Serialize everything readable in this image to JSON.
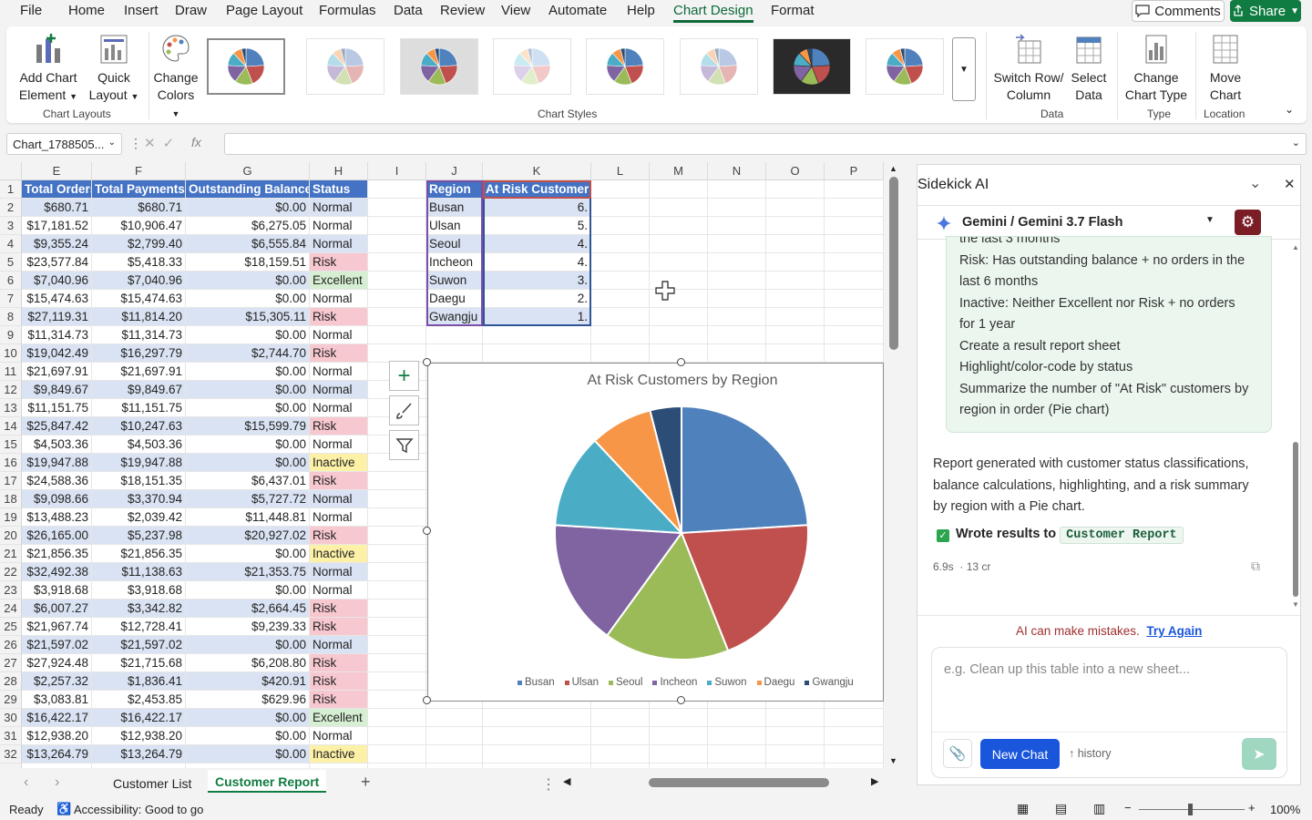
{
  "menu": {
    "items": [
      "File",
      "Home",
      "Insert",
      "Draw",
      "Page Layout",
      "Formulas",
      "Data",
      "Review",
      "View",
      "Automate",
      "Help",
      "Chart Design",
      "Format"
    ],
    "active": "Chart Design",
    "comments": "Comments",
    "share": "Share"
  },
  "ribbon": {
    "add_chart_element": [
      "Add Chart",
      "Element"
    ],
    "quick_layout": [
      "Quick",
      "Layout"
    ],
    "change_colors": [
      "Change",
      "Colors"
    ],
    "switch_row_col": [
      "Switch Row/",
      "Column"
    ],
    "select_data": [
      "Select",
      "Data"
    ],
    "change_chart_type": [
      "Change",
      "Chart Type"
    ],
    "move_chart": [
      "Move",
      "Chart"
    ],
    "groups": {
      "chart_layouts": "Chart Layouts",
      "chart_styles": "Chart Styles",
      "data": "Data",
      "type": "Type",
      "location": "Location"
    }
  },
  "formula_bar": {
    "name_box": "Chart_1788505...",
    "fx": "fx"
  },
  "sheet": {
    "columns": [
      "E",
      "F",
      "G",
      "H",
      "I",
      "J",
      "K",
      "L",
      "M",
      "N",
      "O",
      "P"
    ],
    "headers": {
      "E": "Total Orders",
      "F": "Total Payments",
      "G": "Outstanding Balance",
      "H": "Status",
      "J": "Region",
      "K": "At Risk Customers"
    },
    "rows": [
      [
        "$680.71",
        "$680.71",
        "$0.00",
        "Normal"
      ],
      [
        "$17,181.52",
        "$10,906.47",
        "$6,275.05",
        "Normal"
      ],
      [
        "$9,355.24",
        "$2,799.40",
        "$6,555.84",
        "Normal"
      ],
      [
        "$23,577.84",
        "$5,418.33",
        "$18,159.51",
        "Risk"
      ],
      [
        "$7,040.96",
        "$7,040.96",
        "$0.00",
        "Excellent"
      ],
      [
        "$15,474.63",
        "$15,474.63",
        "$0.00",
        "Normal"
      ],
      [
        "$27,119.31",
        "$11,814.20",
        "$15,305.11",
        "Risk"
      ],
      [
        "$11,314.73",
        "$11,314.73",
        "$0.00",
        "Normal"
      ],
      [
        "$19,042.49",
        "$16,297.79",
        "$2,744.70",
        "Risk"
      ],
      [
        "$21,697.91",
        "$21,697.91",
        "$0.00",
        "Normal"
      ],
      [
        "$9,849.67",
        "$9,849.67",
        "$0.00",
        "Normal"
      ],
      [
        "$11,151.75",
        "$11,151.75",
        "$0.00",
        "Normal"
      ],
      [
        "$25,847.42",
        "$10,247.63",
        "$15,599.79",
        "Risk"
      ],
      [
        "$4,503.36",
        "$4,503.36",
        "$0.00",
        "Normal"
      ],
      [
        "$19,947.88",
        "$19,947.88",
        "$0.00",
        "Inactive"
      ],
      [
        "$24,588.36",
        "$18,151.35",
        "$6,437.01",
        "Risk"
      ],
      [
        "$9,098.66",
        "$3,370.94",
        "$5,727.72",
        "Normal"
      ],
      [
        "$13,488.23",
        "$2,039.42",
        "$11,448.81",
        "Normal"
      ],
      [
        "$26,165.00",
        "$5,237.98",
        "$20,927.02",
        "Risk"
      ],
      [
        "$21,856.35",
        "$21,856.35",
        "$0.00",
        "Inactive"
      ],
      [
        "$32,492.38",
        "$11,138.63",
        "$21,353.75",
        "Normal"
      ],
      [
        "$3,918.68",
        "$3,918.68",
        "$0.00",
        "Normal"
      ],
      [
        "$6,007.27",
        "$3,342.82",
        "$2,664.45",
        "Risk"
      ],
      [
        "$21,967.74",
        "$12,728.41",
        "$9,239.33",
        "Risk"
      ],
      [
        "$21,597.02",
        "$21,597.02",
        "$0.00",
        "Normal"
      ],
      [
        "$27,924.48",
        "$21,715.68",
        "$6,208.80",
        "Risk"
      ],
      [
        "$2,257.32",
        "$1,836.41",
        "$420.91",
        "Risk"
      ],
      [
        "$3,083.81",
        "$2,453.85",
        "$629.96",
        "Risk"
      ],
      [
        "$16,422.17",
        "$16,422.17",
        "$0.00",
        "Excellent"
      ],
      [
        "$12,938.20",
        "$12,938.20",
        "$0.00",
        "Normal"
      ],
      [
        "$13,264.79",
        "$13,264.79",
        "$0.00",
        "Inactive"
      ]
    ],
    "regions": [
      [
        "Busan",
        "6."
      ],
      [
        "Ulsan",
        "5."
      ],
      [
        "Seoul",
        "4."
      ],
      [
        "Incheon",
        "4."
      ],
      [
        "Suwon",
        "3."
      ],
      [
        "Daegu",
        "2."
      ],
      [
        "Gwangju",
        "1."
      ]
    ],
    "status_colors": {
      "Risk": "#f8c8d0",
      "Excellent": "#d6efd2",
      "Inactive": "#fdf1a7",
      "Normal": "#ffffff"
    }
  },
  "chart_data": {
    "type": "pie",
    "title": "At Risk Customers by Region",
    "categories": [
      "Busan",
      "Ulsan",
      "Seoul",
      "Incheon",
      "Suwon",
      "Daegu",
      "Gwangju"
    ],
    "values": [
      6,
      5,
      4,
      4,
      3,
      2,
      1
    ],
    "colors": [
      "#4f81bd",
      "#c0504d",
      "#9bbb59",
      "#8064a2",
      "#4bacc6",
      "#f79646",
      "#2c4d75"
    ],
    "legend": "bottom"
  },
  "sheet_tabs": {
    "tabs": [
      "Customer List",
      "Customer Report"
    ],
    "active": "Customer Report"
  },
  "status": {
    "ready": "Ready",
    "accessibility": "Accessibility: Good to go",
    "zoom": "100%"
  },
  "panel": {
    "title": "Sidekick AI",
    "model": "Gemini / Gemini 3.7 Flash",
    "chat_lines": [
      "the last 3 months",
      "Risk: Has outstanding balance + no orders in the",
      "last 6 months",
      "Inactive: Neither Excellent nor Risk + no orders",
      "for 1 year",
      "Create a result report sheet",
      "Highlight/color-code by status",
      "Summarize the number of \"At Risk\" customers by",
      "region in order (Pie chart)"
    ],
    "response_lines": [
      "Report generated with customer status classifications,",
      "balance calculations, highlighting, and a risk summary",
      "by region with a Pie chart."
    ],
    "wrote_label": "Wrote results to",
    "wrote_target": "Customer Report",
    "meta_time": "6.9s",
    "meta_credits": "· 13 cr",
    "warning": "AI can make mistakes.",
    "try_again": "Try Again",
    "input_placeholder": "e.g. Clean up this table into a new sheet...",
    "new_chat": "New Chat",
    "history": "↑ history"
  }
}
